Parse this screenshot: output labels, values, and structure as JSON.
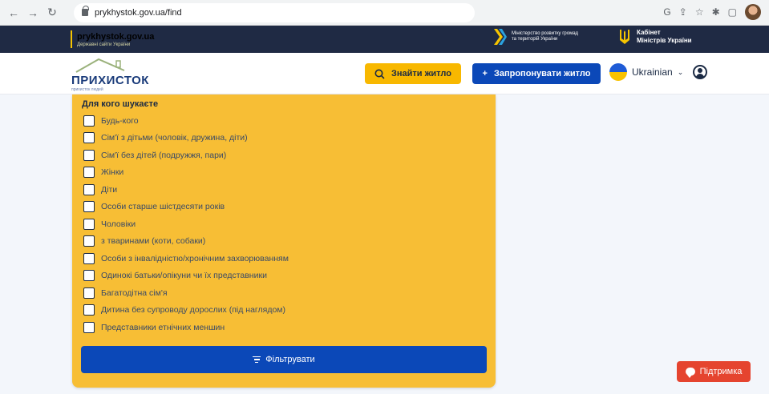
{
  "browser": {
    "url": "prykhystok.gov.ua/find"
  },
  "gov_header": {
    "site": "prykhystok.gov.ua",
    "subtitle": "Державні сайти України",
    "ministry": "Міністерство розвитку громад та територій України",
    "cabinet_line1": "Кабінет",
    "cabinet_line2": "Міністрів України"
  },
  "site_header": {
    "logo": "ПРИХИСТОК",
    "logo_sub": "прихисток людей",
    "find_button": "Знайти житло",
    "offer_button": "Запропонувати житло",
    "language": "Ukrainian"
  },
  "filter": {
    "title": "Для кого шукаєте",
    "options": [
      "Будь-кого",
      "Сім'ї з дітьми (чоловік, дружина, діти)",
      "Сім'ї без дітей (подружжя, пари)",
      "Жінки",
      "Діти",
      "Особи старше шістдесяти років",
      "Чоловіки",
      "з тваринами (коти, собаки)",
      "Особи з інвалідністю/хронічним захворюванням",
      "Одинокі батьки/опікуни чи їх представники",
      "Багатодітна сім'я",
      "Дитина без супроводу дорослих (під наглядом)",
      "Представники етнічних меншин"
    ],
    "submit": "Фільтрувати"
  },
  "support": {
    "label": "Підтримка"
  },
  "colors": {
    "panel": "#f7be35",
    "primary": "#0b48b8",
    "gov_bar": "#1f2a44",
    "support": "#e5442f"
  }
}
